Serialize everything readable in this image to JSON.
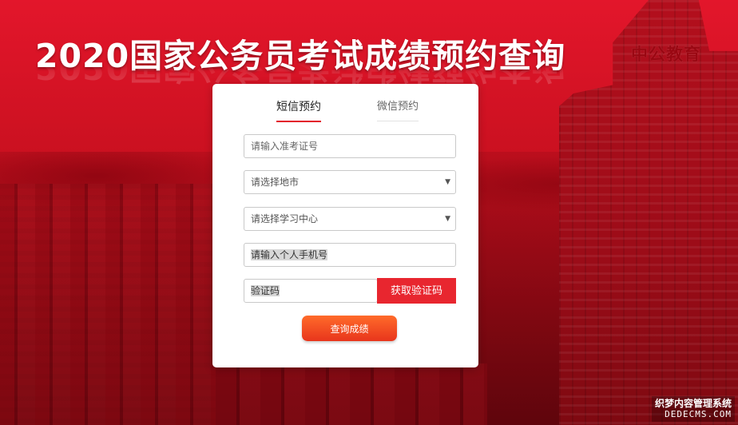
{
  "banner": {
    "title": "2020国家公务员考试成绩预约查询",
    "tower_sign": "中公教育"
  },
  "form": {
    "tabs": [
      {
        "label": "短信预约",
        "active": true
      },
      {
        "label": "微信预约",
        "active": false
      }
    ],
    "exam_id_placeholder": "请输入准考证号",
    "city_select": "请选择地市",
    "center_select": "请选择学习中心",
    "phone_value": "请输入个人手机号",
    "code_value": "验证码",
    "get_code_label": "获取验证码",
    "submit_label": "查询成绩"
  },
  "watermark": {
    "line1": "织梦内容管理系统",
    "line2": "DEDECMS.COM"
  },
  "colors": {
    "brand_red": "#e3162b",
    "button_red": "#e8262f",
    "submit_orange": "#ff6b2a"
  }
}
